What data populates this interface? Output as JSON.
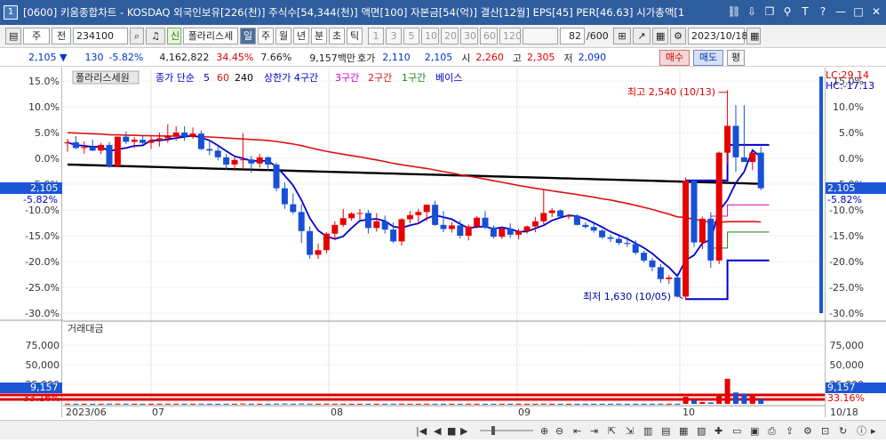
{
  "window": {
    "number": "1",
    "title": "[0600] 키움종합차트 - KOSDAQ 외국인보유[226(천)] 주식수[54,344(천)] 액면[100] 자본금[54(억)] 결산[12월] EPS[45] PER[46.63] 시가총액[1"
  },
  "toolbar": {
    "market_label": "주",
    "market2_label": "전",
    "code": "234100",
    "type_label": "신",
    "indicator_label": "폴라리스세",
    "periods": [
      "일",
      "주",
      "월",
      "년",
      "분",
      "초",
      "틱"
    ],
    "intervals": [
      "1",
      "3",
      "5",
      "10",
      "20",
      "30",
      "60",
      "120"
    ],
    "count": "82",
    "count_max": "/600",
    "date": "2023/10/18"
  },
  "quote": {
    "price": "2,105 ▼",
    "change": "130",
    "change_pct": "-5.82%",
    "volume": "4,162,822",
    "turnover_pct": "34.45%",
    "ratio_pct": "7.66%",
    "amount": "9,157백만",
    "bid_label": "호가",
    "bid": "2,110",
    "ask": "2,105",
    "open_label": "시",
    "open": "2,260",
    "high_label": "고",
    "high": "2,305",
    "low_label": "저",
    "low": "2,090",
    "buy_label": "매수",
    "sell_label": "매도",
    "eval_label": "평"
  },
  "legend": {
    "name": "폴라리스세원",
    "ma": "종가 단순",
    "ma5": "5",
    "ma60": "60",
    "ma240": "240",
    "env": "상한가 4구간",
    "env3": "3구간",
    "env2": "2구간",
    "env1": "1구간",
    "base": "베이스"
  },
  "annotations": {
    "high": "최고 2,540 (10/13)",
    "low": "최저 1,630 (10/05)",
    "lc": "LC:29.14",
    "hc": "HC:-17.13"
  },
  "price_axis": {
    "labels": [
      "15.0%",
      "10.0%",
      "5.0%",
      "0.0%",
      "-5.0%",
      "-10.0%",
      "-15.0%",
      "-20.0%",
      "-25.0%",
      "-30.0%"
    ],
    "current": "2,105",
    "current_pct": "-5.82%"
  },
  "volume_panel": {
    "title": "거래대금",
    "labels": [
      "75,000",
      "50,000",
      "25,000"
    ],
    "current": "9,157",
    "current_pct": "33.16%"
  },
  "x_axis": {
    "labels": [
      "2023/06",
      "07",
      "08",
      "09",
      "10",
      "10/18"
    ]
  },
  "colors": {
    "up": "#e60000",
    "down": "#1750d6",
    "ma5": "#0000cc",
    "ma60": "#dd1111",
    "ma240": "#000000",
    "title_bar": "#2e5d9e"
  },
  "chart_data": {
    "type": "candlestick",
    "y_unit": "% change vs. base",
    "ylim": [
      -30,
      15
    ],
    "volume_ylim": [
      0,
      100000
    ],
    "candles": [
      [
        2.9,
        3.8,
        1.3,
        3.1
      ],
      [
        3.1,
        4.3,
        1.8,
        2.0
      ],
      [
        2.0,
        3.3,
        0.9,
        2.2
      ],
      [
        2.2,
        3.6,
        1.4,
        1.5
      ],
      [
        1.5,
        3.0,
        0.8,
        2.6
      ],
      [
        2.6,
        3.2,
        -1.8,
        -1.5
      ],
      [
        -1.5,
        4.2,
        -1.7,
        4.2
      ],
      [
        4.2,
        5.2,
        2.8,
        3.2
      ],
      [
        3.2,
        4.1,
        2.0,
        3.6
      ],
      [
        3.6,
        4.5,
        2.6,
        3.0
      ],
      [
        3.0,
        4.3,
        1.8,
        3.5
      ],
      [
        3.5,
        5.0,
        2.3,
        3.9
      ],
      [
        3.9,
        6.6,
        3.0,
        4.3
      ],
      [
        4.3,
        6.2,
        3.4,
        5.0
      ],
      [
        5.0,
        6.2,
        3.4,
        4.2
      ],
      [
        4.2,
        6.0,
        3.8,
        4.8
      ],
      [
        4.8,
        5.4,
        1.6,
        1.8
      ],
      [
        1.8,
        3.5,
        0.6,
        1.5
      ],
      [
        1.5,
        2.6,
        -0.4,
        0.2
      ],
      [
        0.2,
        0.9,
        -2.2,
        -1.2
      ],
      [
        -1.2,
        0.2,
        -2.4,
        -0.3
      ],
      [
        -0.3,
        4.9,
        -2.2,
        -0.2
      ],
      [
        -0.2,
        0.5,
        -2.8,
        -1.0
      ],
      [
        -1.0,
        0.9,
        -1.8,
        0.2
      ],
      [
        0.2,
        0.4,
        -2.5,
        -1.2
      ],
      [
        -1.2,
        -0.8,
        -6.4,
        -5.8
      ],
      [
        -5.8,
        -4.6,
        -9.8,
        -8.9
      ],
      [
        -8.9,
        -6.8,
        -10.8,
        -10.4
      ],
      [
        -10.4,
        -8.9,
        -16.4,
        -14.1
      ],
      [
        -14.1,
        -13.2,
        -19.4,
        -18.7
      ],
      [
        -18.7,
        -16.5,
        -19.5,
        -17.8
      ],
      [
        -17.8,
        -14.3,
        -18.4,
        -14.6
      ],
      [
        -14.6,
        -12.2,
        -15.9,
        -12.9
      ],
      [
        -12.9,
        -9.8,
        -13.3,
        -11.6
      ],
      [
        -11.6,
        -10.4,
        -12.1,
        -10.7
      ],
      [
        -10.7,
        -9.8,
        -11.9,
        -10.6
      ],
      [
        -10.6,
        -10.0,
        -14.6,
        -13.5
      ],
      [
        -13.5,
        -10.6,
        -14.2,
        -12.2
      ],
      [
        -12.2,
        -11.1,
        -14.6,
        -13.8
      ],
      [
        -13.8,
        -12.4,
        -16.4,
        -16.1
      ],
      [
        -16.1,
        -11.6,
        -16.9,
        -11.8
      ],
      [
        -11.8,
        -10.2,
        -12.6,
        -11.0
      ],
      [
        -11.0,
        -9.8,
        -12.6,
        -10.4
      ],
      [
        -10.4,
        -8.9,
        -12.1,
        -9.0
      ],
      [
        -9.0,
        -8.2,
        -13.1,
        -12.9
      ],
      [
        -12.9,
        -10.2,
        -14.3,
        -13.7
      ],
      [
        -13.7,
        -12.3,
        -14.4,
        -13.0
      ],
      [
        -13.0,
        -12.0,
        -15.5,
        -15.0
      ],
      [
        -15.0,
        -12.8,
        -15.9,
        -13.2
      ],
      [
        -13.2,
        -11.2,
        -13.6,
        -11.5
      ],
      [
        -11.5,
        -10.2,
        -13.7,
        -13.4
      ],
      [
        -13.4,
        -13.0,
        -15.6,
        -15.2
      ],
      [
        -15.2,
        -13.2,
        -15.6,
        -13.6
      ],
      [
        -13.6,
        -12.6,
        -15.4,
        -14.8
      ],
      [
        -14.8,
        -13.6,
        -15.7,
        -14.1
      ],
      [
        -14.1,
        -13.0,
        -14.6,
        -13.2
      ],
      [
        -13.2,
        -11.4,
        -14.3,
        -12.2
      ],
      [
        -12.2,
        -6.1,
        -12.8,
        -10.6
      ],
      [
        -10.6,
        -9.6,
        -11.4,
        -10.1
      ],
      [
        -10.1,
        -9.9,
        -11.7,
        -11.3
      ],
      [
        -11.3,
        -10.8,
        -11.8,
        -11.1
      ],
      [
        -11.1,
        -10.8,
        -13.0,
        -12.9
      ],
      [
        -12.9,
        -12.4,
        -13.6,
        -13.3
      ],
      [
        -13.3,
        -12.6,
        -14.4,
        -14.0
      ],
      [
        -14.0,
        -13.8,
        -15.6,
        -15.3
      ],
      [
        -15.3,
        -14.8,
        -16.2,
        -15.6
      ],
      [
        -15.6,
        -15.1,
        -16.8,
        -16.4
      ],
      [
        -16.4,
        -15.2,
        -17.2,
        -16.6
      ],
      [
        -16.6,
        -15.9,
        -18.7,
        -18.3
      ],
      [
        -18.3,
        -17.9,
        -20.2,
        -19.8
      ],
      [
        -19.8,
        -19.3,
        -21.9,
        -21.1
      ],
      [
        -21.1,
        -20.5,
        -24.1,
        -23.4
      ],
      [
        -23.4,
        -22.6,
        -24.3,
        -23.1
      ],
      [
        -23.1,
        -22.3,
        -27.0,
        -26.8
      ],
      [
        -26.8,
        -3.7,
        -27.5,
        -4.3
      ],
      [
        -4.3,
        -4.2,
        -17.2,
        -16.3
      ],
      [
        -16.3,
        -11.3,
        -17.6,
        -11.7
      ],
      [
        -11.7,
        -10.4,
        -21.2,
        -19.8
      ],
      [
        -19.8,
        1.3,
        -20.5,
        1.1
      ],
      [
        1.1,
        13.2,
        -1.1,
        6.3
      ],
      [
        6.3,
        10.3,
        -2.6,
        0.2
      ],
      [
        0.2,
        10.3,
        -0.3,
        -0.7
      ],
      [
        -0.7,
        0.9,
        -2.3,
        1.1
      ],
      [
        1.1,
        2.3,
        -6.2,
        -5.8
      ]
    ],
    "volume": [
      220,
      180,
      150,
      140,
      160,
      260,
      320,
      240,
      180,
      160,
      170,
      230,
      260,
      250,
      200,
      190,
      260,
      160,
      150,
      180,
      170,
      400,
      220,
      160,
      180,
      320,
      420,
      260,
      380,
      300,
      200,
      260,
      240,
      200,
      160,
      150,
      200,
      160,
      150,
      170,
      260,
      160,
      150,
      200,
      190,
      170,
      140,
      170,
      200,
      160,
      160,
      150,
      140,
      150,
      160,
      140,
      140,
      300,
      160,
      140,
      130,
      140,
      130,
      140,
      150,
      140,
      150,
      160,
      170,
      180,
      200,
      220,
      200,
      260,
      9000,
      4200,
      2400,
      1800,
      10000,
      32000,
      14500,
      13200,
      11800,
      5900
    ]
  }
}
